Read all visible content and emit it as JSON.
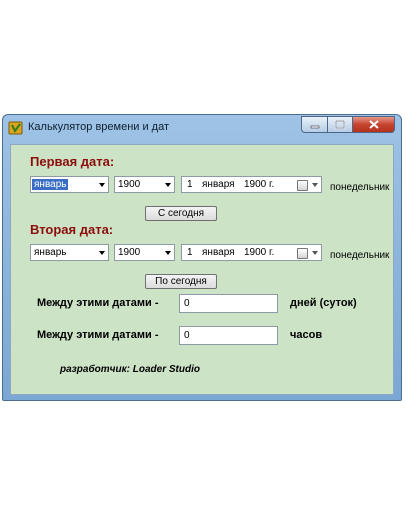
{
  "window": {
    "title": "Калькулятор времени и дат",
    "minimize_icon": "minimize-icon",
    "maximize_icon": "maximize-icon",
    "close_icon": "close-icon",
    "app_icon": "app-icon"
  },
  "first": {
    "title": "Первая дата:",
    "month": "январь",
    "year": "1900",
    "date_day": "1",
    "date_month": "января",
    "date_year": "1900 г.",
    "weekday": "понедельник",
    "today_button": "С сегодня"
  },
  "second": {
    "title": "Вторая дата:",
    "month": "январь",
    "year": "1900",
    "date_day": "1",
    "date_month": "января",
    "date_year": "1900 г.",
    "weekday": "понедельник",
    "today_button": "По сегодня"
  },
  "results": {
    "days_label": "Между этими датами -",
    "days_value": "0",
    "days_unit": "дней (суток)",
    "hours_label": "Между этими датами -",
    "hours_value": "0",
    "hours_unit": "часов"
  },
  "footer": {
    "credit": "разработчик: Loader Studio"
  },
  "colors": {
    "client_bg": "#cde3c6",
    "section_title": "#8b0d0d",
    "selection": "#3b6fc6",
    "close_button": "#c5432f"
  }
}
